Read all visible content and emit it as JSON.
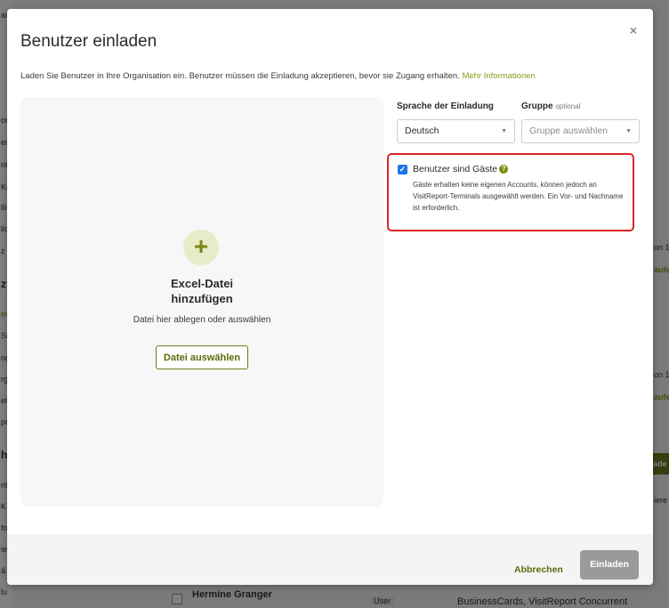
{
  "background": {
    "left_fragments": [
      "al",
      "or",
      "eit",
      "nt",
      "Ko",
      "llis",
      "lic",
      "z",
      "zt",
      "er",
      "Si",
      "og",
      "rg",
      "el",
      "po",
      "hi",
      "nt",
      "K",
      "fo",
      "ie",
      "&",
      "lu"
    ],
    "right_fragments": [
      "on 1",
      "aufe",
      "on 1",
      "aufe",
      "ade",
      "iere"
    ],
    "row": {
      "name": "Hermine Granger",
      "role": "User",
      "licenses": "BusinessCards, VisitReport Concurrent"
    }
  },
  "modal": {
    "title": "Benutzer einladen",
    "close_label": "×",
    "intro_text": "Laden Sie Benutzer in Ihre Organisation ein. Benutzer müssen die Einladung akzeptieren, bevor sie Zugang erhalten.",
    "intro_link": "Mehr Informationen",
    "dropzone": {
      "plus": "+",
      "title_line1": "Excel-Datei",
      "title_line2": "hinzufügen",
      "subtitle": "Datei hier ablegen oder auswählen",
      "button_label": "Datei auswählen"
    },
    "language": {
      "label": "Sprache der Einladung",
      "value": "Deutsch"
    },
    "group": {
      "label": "Gruppe",
      "optional": "optional",
      "placeholder": "Gruppe auswählen"
    },
    "guests": {
      "checked": true,
      "label": "Benutzer sind Gäste",
      "description": "Gäste erhalten keine eigenen Accounts, können jedoch an VisitReport-Terminals ausgewählt werden. Ein Vor- und Nachname ist erforderlich."
    },
    "footer": {
      "cancel_label": "Abbrechen",
      "invite_label": "Einladen"
    }
  },
  "colors": {
    "accent": "#7a8a10",
    "highlight_border": "#e02424",
    "checkbox": "#1a73e8",
    "disabled_button": "#9a9a9a"
  },
  "icons": {
    "close": "close-icon",
    "plus": "plus-icon",
    "help": "help-icon",
    "caret": "chevron-down-icon",
    "check": "check-icon"
  }
}
